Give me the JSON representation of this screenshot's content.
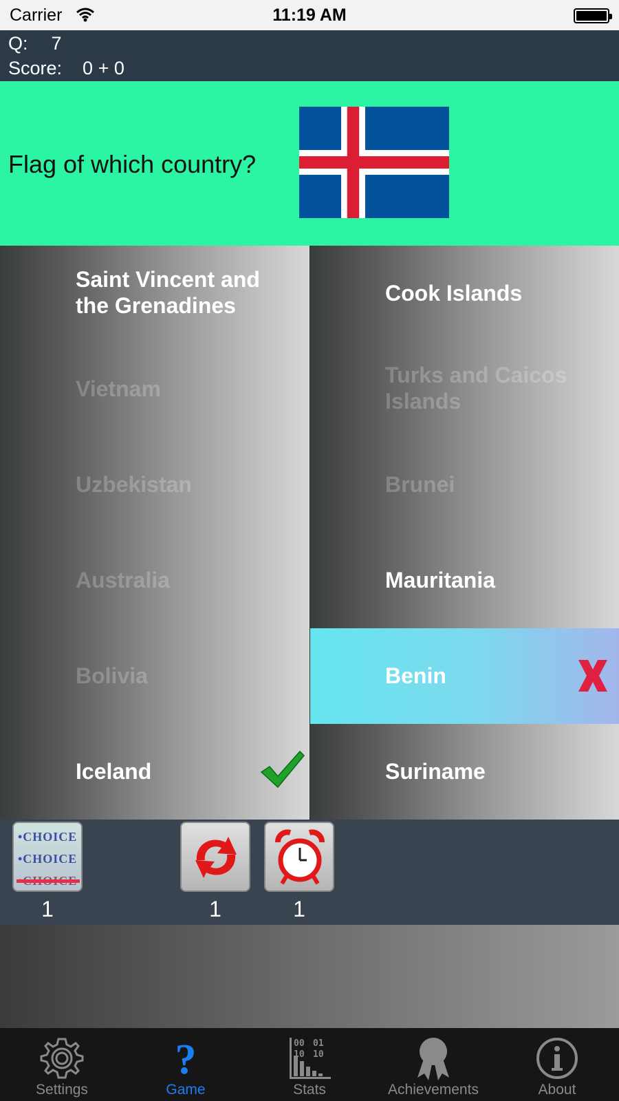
{
  "status_bar": {
    "carrier": "Carrier",
    "time": "11:19 AM"
  },
  "info_bar": {
    "question_label": "Q:",
    "question_number": "7",
    "score_label": "Score:",
    "score_value": "0 + 0"
  },
  "question": {
    "prompt": "Flag of which country?",
    "flag_icon": "iceland-flag"
  },
  "answers": {
    "left": [
      {
        "label": "Saint Vincent and the Grenadines",
        "state": "active"
      },
      {
        "label": "Vietnam",
        "state": "faded"
      },
      {
        "label": "Uzbekistan",
        "state": "faded"
      },
      {
        "label": "Australia",
        "state": "faded"
      },
      {
        "label": "Bolivia",
        "state": "faded"
      },
      {
        "label": "Iceland",
        "state": "correct"
      }
    ],
    "right": [
      {
        "label": "Cook Islands",
        "state": "active"
      },
      {
        "label": "Turks and Caicos Islands",
        "state": "faded"
      },
      {
        "label": "Brunei",
        "state": "faded"
      },
      {
        "label": "Mauritania",
        "state": "active"
      },
      {
        "label": "Benin",
        "state": "wrong-selected"
      },
      {
        "label": "Suriname",
        "state": "active"
      }
    ]
  },
  "powerups": [
    {
      "name": "choice-powerup",
      "icon": "choice-icon",
      "count": "1",
      "choice_text": "•CHOICE"
    },
    {
      "name": "swap-powerup",
      "icon": "refresh-arrows-icon",
      "count": "1"
    },
    {
      "name": "time-powerup",
      "icon": "alarm-clock-icon",
      "count": "1"
    }
  ],
  "tabs": [
    {
      "label": "Settings",
      "icon": "gear-icon",
      "active": false
    },
    {
      "label": "Game",
      "icon": "question-mark-icon",
      "active": true
    },
    {
      "label": "Stats",
      "icon": "stats-chart-icon",
      "active": false,
      "icon_digits": [
        "00",
        "01",
        "10",
        "10"
      ]
    },
    {
      "label": "Achievements",
      "icon": "award-ribbon-icon",
      "active": false
    },
    {
      "label": "About",
      "icon": "info-icon",
      "active": false
    }
  ],
  "colors": {
    "info_bar": "#2c3a48",
    "question_bg": "#2bf5a2",
    "selected_cell": "#65e6ee",
    "active_tab": "#1a7ef5",
    "correct_mark": "#1fa12a",
    "wrong_mark": "#e02040"
  }
}
